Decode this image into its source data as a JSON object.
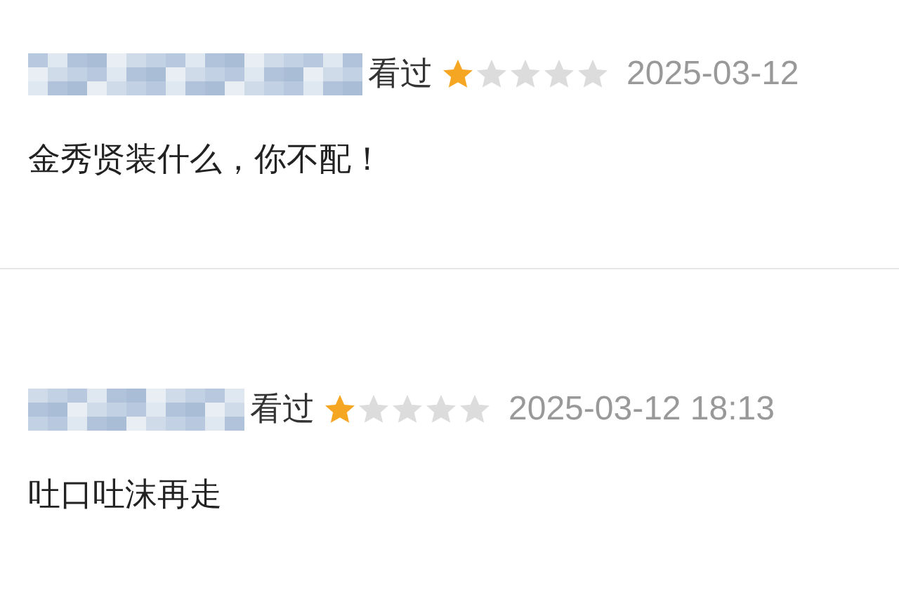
{
  "reviews": [
    {
      "status": "看过",
      "stars": 1,
      "date": "2025-03-12",
      "comment": "金秀贤装什么，你不配！"
    },
    {
      "status": "看过",
      "stars": 1,
      "date": "2025-03-12 18:13",
      "comment": "吐口吐沫再走"
    }
  ]
}
